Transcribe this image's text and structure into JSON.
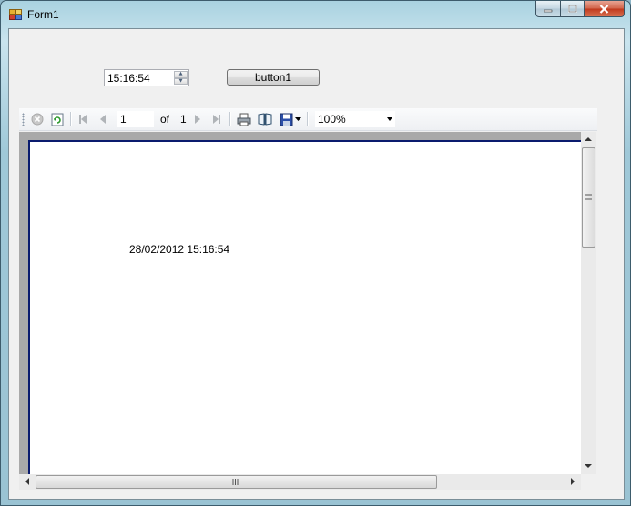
{
  "window": {
    "title": "Form1"
  },
  "form": {
    "time_value": "15:16:54",
    "button_label": "button1"
  },
  "report_toolbar": {
    "current_page": "1",
    "of_label": "of",
    "total_pages": "1",
    "zoom": "100%"
  },
  "report": {
    "timestamp_text": "28/02/2012 15:16:54"
  },
  "icons": [
    "app-form-icon",
    "minimize-icon",
    "maximize-icon",
    "close-icon",
    "stop-icon",
    "refresh-icon",
    "first-page-icon",
    "previous-page-icon",
    "next-page-icon",
    "last-page-icon",
    "print-icon",
    "print-layout-icon",
    "save-icon",
    "dropdown-icon"
  ],
  "colors": {
    "page_border": "#0a1b6e",
    "viewer_background": "#a9a9a9",
    "close_button": "#c0391d"
  }
}
